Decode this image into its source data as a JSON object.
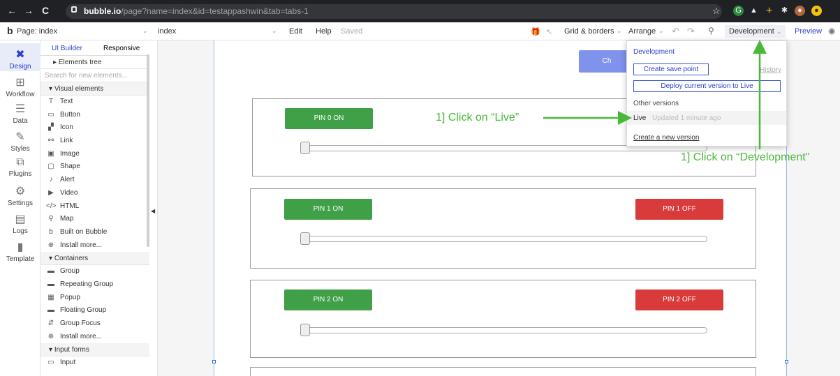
{
  "browser": {
    "url_host": "bubble.io",
    "url_path": "/page?name=index&id=testappashwin&tab=tabs-1"
  },
  "toolbar": {
    "page_label": "Page: index",
    "index_label": "index",
    "edit_label": "Edit",
    "help_label": "Help",
    "saved_label": "Saved",
    "grid_label": "Grid & borders",
    "arrange_label": "Arrange",
    "development_label": "Development",
    "preview_label": "Preview"
  },
  "rail": {
    "items": [
      {
        "label": "Design",
        "icon": "design-icon"
      },
      {
        "label": "Workflow",
        "icon": "workflow-icon"
      },
      {
        "label": "Data",
        "icon": "data-icon"
      },
      {
        "label": "Styles",
        "icon": "styles-icon"
      },
      {
        "label": "Plugins",
        "icon": "plugins-icon"
      },
      {
        "label": "Settings",
        "icon": "settings-icon"
      },
      {
        "label": "Logs",
        "icon": "logs-icon"
      },
      {
        "label": "Template",
        "icon": "template-icon"
      }
    ]
  },
  "panel": {
    "tab_ui_builder": "UI Builder",
    "tab_responsive": "Responsive",
    "elements_tree": "Elements tree",
    "search_placeholder": "Search for new elements...",
    "section_visual": "Visual elements",
    "visual_items": [
      "Text",
      "Button",
      "Icon",
      "Link",
      "Image",
      "Shape",
      "Alert",
      "Video",
      "HTML",
      "Map",
      "Built on Bubble",
      "Install more..."
    ],
    "section_containers": "Containers",
    "container_items": [
      "Group",
      "Repeating Group",
      "Popup",
      "Floating Group",
      "Group Focus",
      "Install more..."
    ],
    "section_input": "Input forms",
    "input_items": [
      "Input"
    ]
  },
  "canvas": {
    "top_button_partial": "Ch",
    "pins": [
      {
        "on": "PIN 0 ON",
        "off": ""
      },
      {
        "on": "PIN 1 ON",
        "off": "PIN 1 OFF"
      },
      {
        "on": "PIN 2 ON",
        "off": "PIN 2 OFF"
      }
    ]
  },
  "dropdown": {
    "title": "Development",
    "create_save_point": "Create save point",
    "history_partial": "History",
    "deploy": "Deploy current version to Live",
    "other_versions": "Other versions",
    "live_label": "Live",
    "live_updated": "Updated 1 minute ago",
    "create_new_version": "Create a new version"
  },
  "annotations": {
    "live": "1] Click on “Live”",
    "development": "1] Click on “Development”"
  },
  "colors": {
    "accent": "#2c3fc8",
    "pin_on": "#3fa048",
    "pin_off": "#d93a3a",
    "annotation": "#49b838"
  }
}
